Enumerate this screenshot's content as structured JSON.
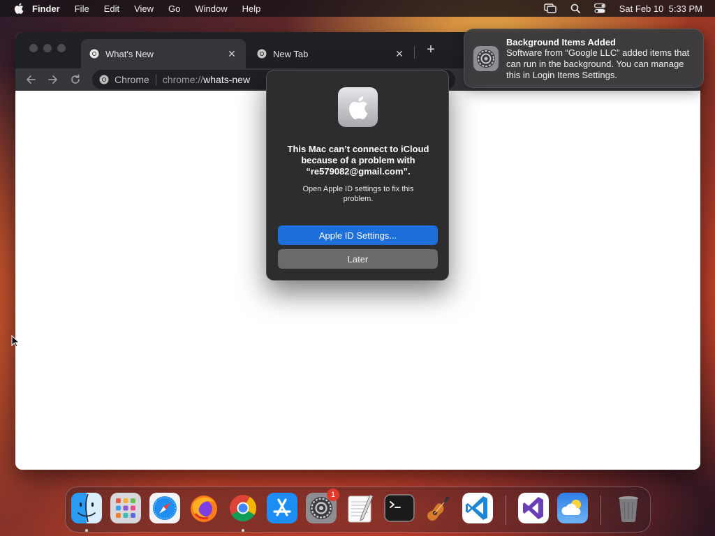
{
  "menubar": {
    "app_name": "Finder",
    "menus": [
      "File",
      "Edit",
      "View",
      "Go",
      "Window",
      "Help"
    ],
    "datetime": "Sat Feb 10  5:33 PM"
  },
  "browser": {
    "tabs": [
      {
        "label": "What's New",
        "active": true
      },
      {
        "label": "New Tab",
        "active": false
      }
    ],
    "omnibox": {
      "site_name": "Chrome",
      "url_scheme": "chrome://",
      "url_host": "whats-new"
    }
  },
  "notification": {
    "title": "Background Items Added",
    "body": "Software from “Google LLC” added items that can run in the background. You can manage this in Login Items Settings.",
    "icon": "system-settings-icon"
  },
  "dialog": {
    "title": "This Mac can’t connect to iCloud because of a problem with “re579082@gmail.com”.",
    "message": "Open Apple ID settings to fix this problem.",
    "primary_button": "Apple ID Settings...",
    "secondary_button": "Later",
    "primary_color": "#1d6fdc"
  },
  "dock": {
    "items": [
      "Finder",
      "Launchpad",
      "Safari",
      "Firefox",
      "Google Chrome",
      "App Store",
      "System Settings",
      "TextEdit",
      "Terminal",
      "GarageBand",
      "Visual Studio Code",
      "Visual Studio",
      "Weather",
      "Trash"
    ],
    "system_settings_badge": "1"
  }
}
